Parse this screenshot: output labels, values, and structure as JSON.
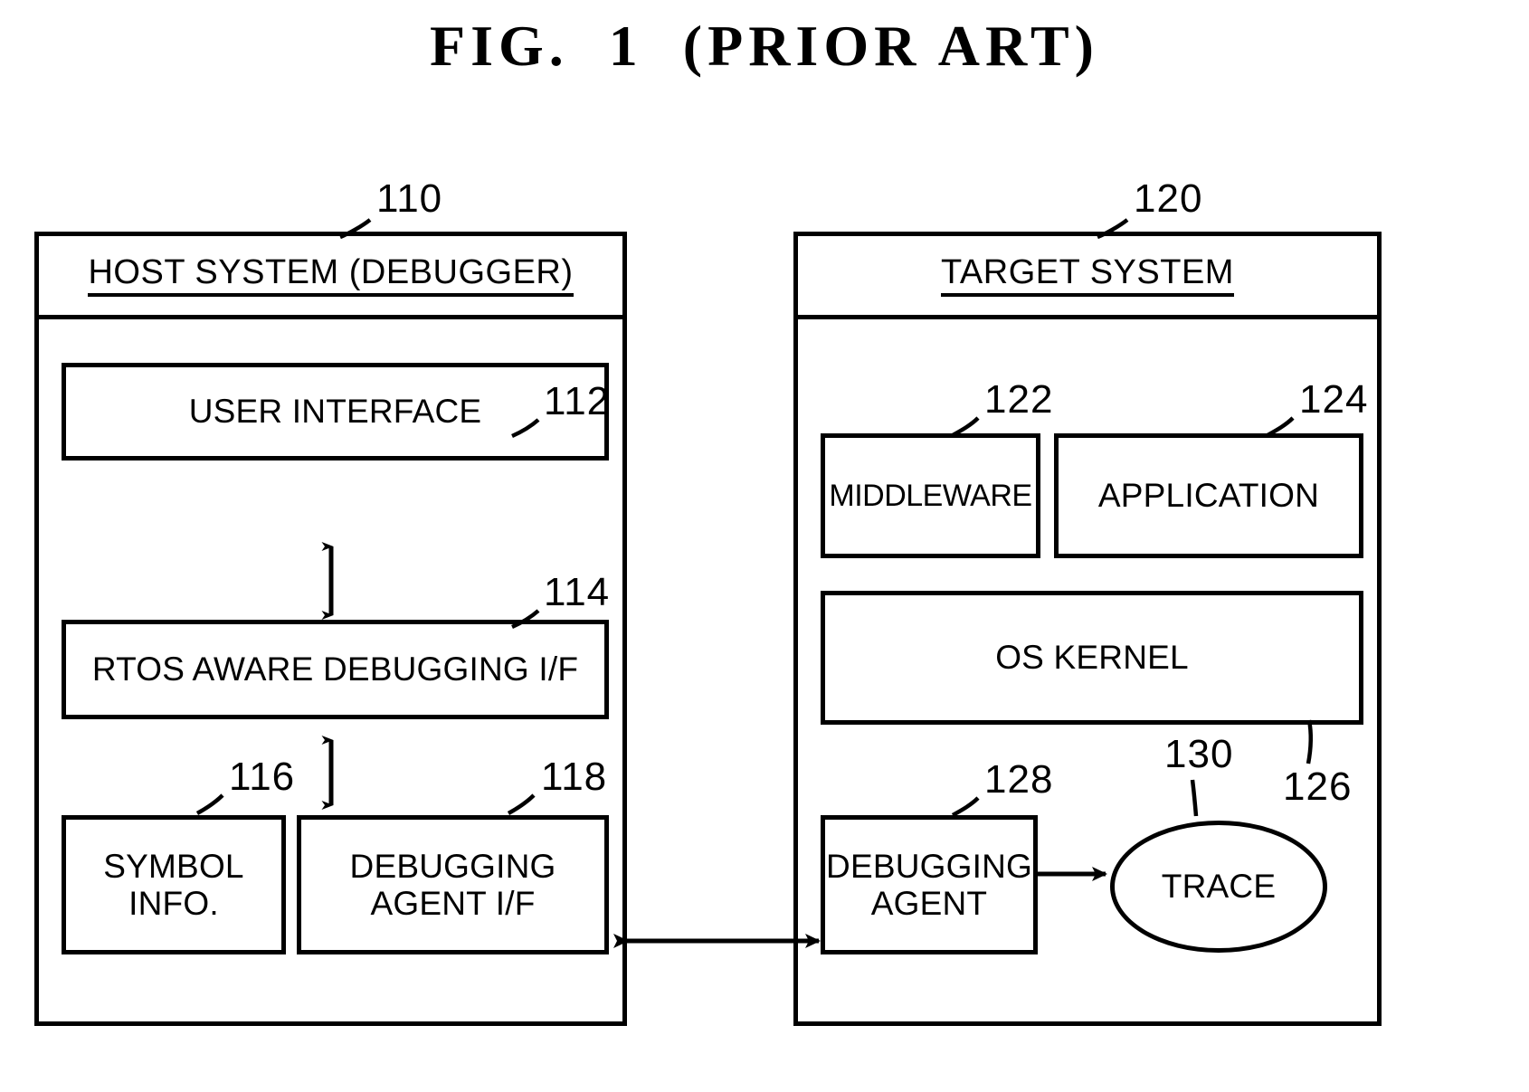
{
  "figure": {
    "title": "FIG.  1  (PRIOR ART)"
  },
  "host_system": {
    "title": "HOST SYSTEM (DEBUGGER)",
    "ref": "110",
    "blocks": [
      {
        "label": "USER INTERFACE",
        "ref": "112"
      },
      {
        "label": "RTOS AWARE DEBUGGING I/F",
        "ref": "114"
      },
      {
        "label_line1": "SYMBOL",
        "label_line2": "INFO.",
        "ref": "116"
      },
      {
        "label_line1": "DEBUGGING",
        "label_line2": "AGENT I/F",
        "ref": "118"
      }
    ]
  },
  "target_system": {
    "title": "TARGET SYSTEM",
    "ref": "120",
    "blocks": [
      {
        "label": "MIDDLEWARE",
        "ref": "122"
      },
      {
        "label": "APPLICATION",
        "ref": "124"
      },
      {
        "label": "OS KERNEL",
        "ref": "126"
      },
      {
        "label_line1": "DEBUGGING",
        "label_line2": "AGENT",
        "ref": "128"
      },
      {
        "label": "TRACE",
        "ref": "130"
      }
    ]
  },
  "connections": [
    {
      "name": "user-interface-to-rtos-if",
      "style": "double-arrow-vertical"
    },
    {
      "name": "rtos-if-to-debugging-agent-if",
      "style": "double-arrow-vertical"
    },
    {
      "name": "host-to-target-link",
      "style": "double-arrow-horizontal"
    },
    {
      "name": "debugging-agent-to-trace",
      "style": "single-arrow-right"
    }
  ],
  "colors": {
    "ink": "#000000",
    "paper": "#ffffff"
  }
}
